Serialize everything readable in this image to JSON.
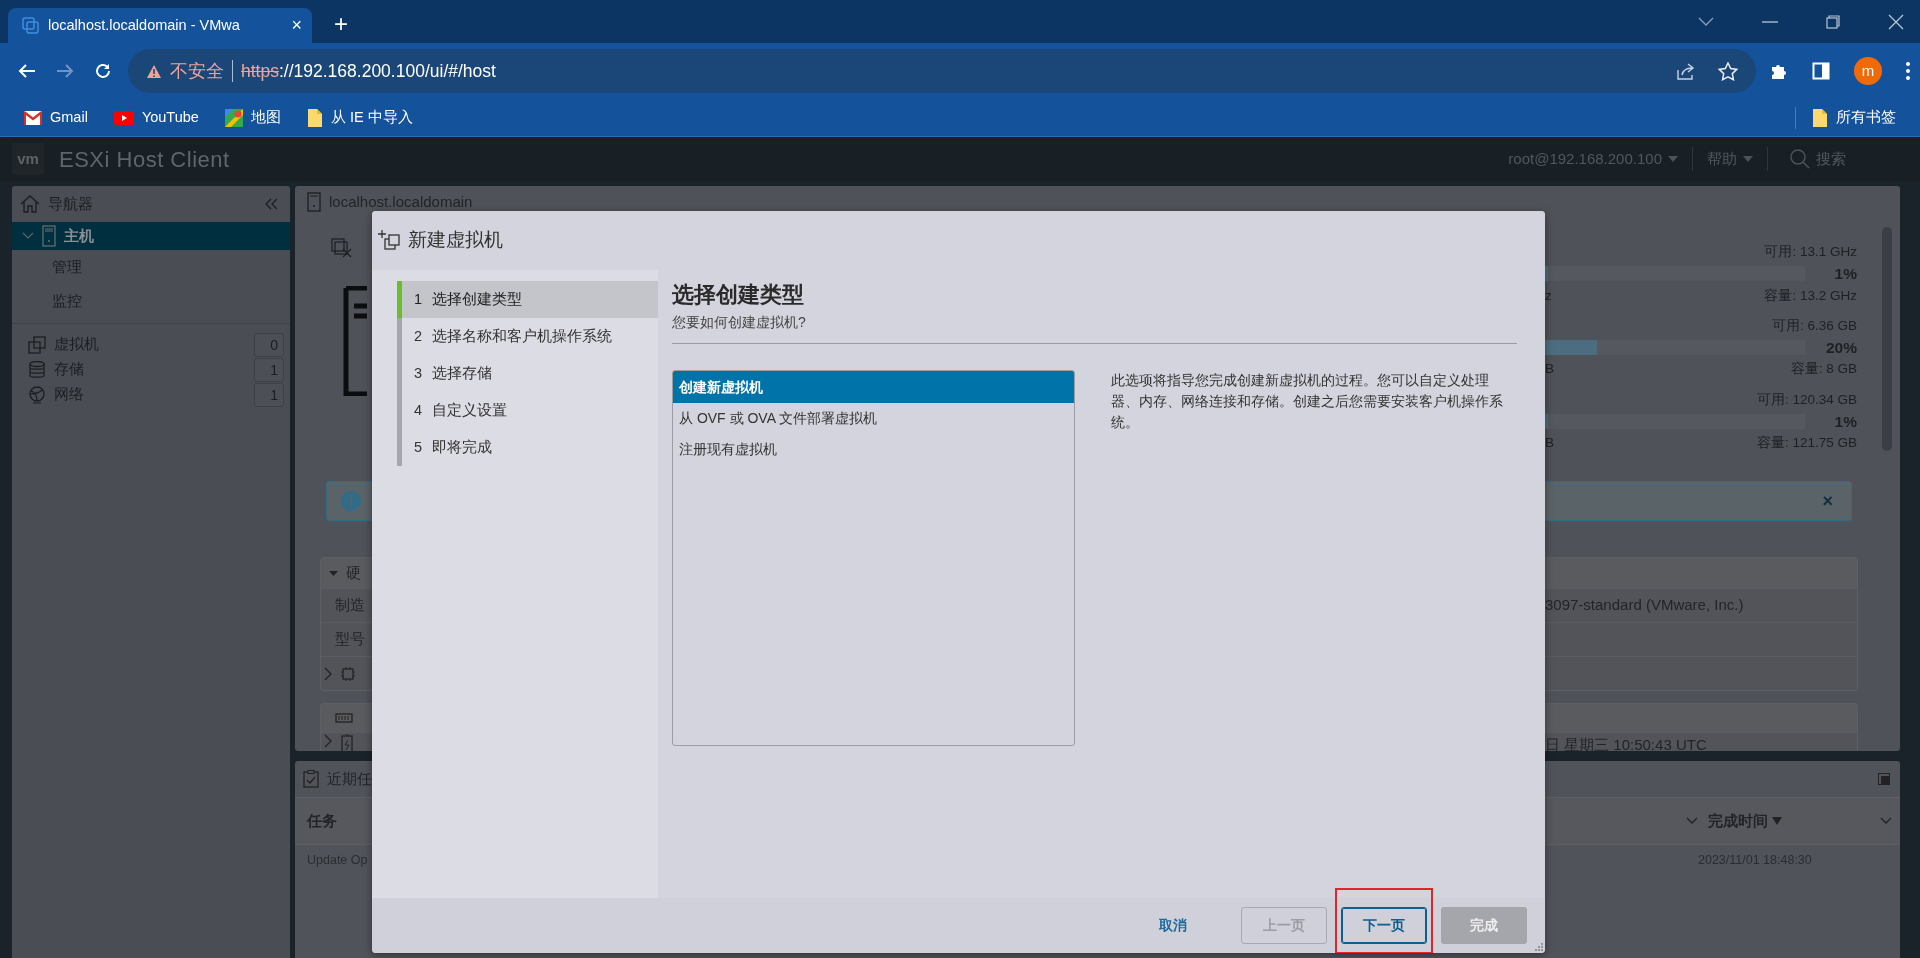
{
  "browser": {
    "tab": {
      "title": "localhost.localdomain - VMwa",
      "close": "×"
    },
    "new_tab": "+",
    "nav_buttons": [
      {
        "kind": "back",
        "disabled": false
      },
      {
        "kind": "forward",
        "disabled": true
      },
      {
        "kind": "reload",
        "disabled": false
      }
    ],
    "address": {
      "security": "不安全",
      "scheme": "https",
      "rest": "://192.168.200.100/ui/#/host"
    },
    "profile": "m",
    "bookmarks": [
      {
        "kind": "gmail",
        "label": "Gmail"
      },
      {
        "kind": "youtube",
        "label": "YouTube"
      },
      {
        "kind": "maps",
        "label": "地图"
      },
      {
        "kind": "folder",
        "label": "从 IE 中导入"
      }
    ],
    "all_bookmarks": "所有书签"
  },
  "app_header": {
    "logo": "vm",
    "title": "ESXi Host Client",
    "user": "root@192.168.200.100",
    "help": "帮助",
    "search": "搜索"
  },
  "navigator": {
    "title": "导航器",
    "items": [
      {
        "label": "主机",
        "selected": true,
        "expanded": true,
        "children": [
          {
            "label": "管理",
            "selected": false
          },
          {
            "label": "监控",
            "selected": false
          }
        ]
      }
    ],
    "inventory": [
      {
        "kind": "vms",
        "label": "虚拟机",
        "count": "0"
      },
      {
        "kind": "storage",
        "label": "存储",
        "count": "1"
      },
      {
        "kind": "network",
        "label": "网络",
        "count": "1"
      }
    ]
  },
  "host_panel": {
    "title": "localhost.localdomain",
    "resources": [
      {
        "available": "可用: 13.1 GHz",
        "percent": "1%",
        "level": 0.01,
        "capacity": "容量: 13.2 GHz",
        "fragment": "z"
      },
      {
        "available": "可用: 6.36 GB",
        "percent": "20%",
        "level": 0.2,
        "capacity": "容量: 8 GB",
        "fragment": "B"
      },
      {
        "available": "可用: 120.34 GB",
        "percent": "1%",
        "level": 0.01,
        "capacity": "容量: 121.75 GB",
        "fragment": "B"
      }
    ],
    "alert": {
      "close": "×"
    },
    "hardware": {
      "title": "硬",
      "expanded": true,
      "rows": [
        {
          "kind": "text",
          "label": "制造",
          "value": "3097-standard (VMware, Inc.)"
        },
        {
          "kind": "text",
          "label": "型号"
        },
        {
          "kind": "cpu",
          "expanded": false
        }
      ]
    },
    "system": {
      "rows": [
        {
          "kind": "memory"
        },
        {
          "kind": "device",
          "expanded": false,
          "value": "日 星期三 10:50:43 UTC"
        }
      ]
    }
  },
  "tasks": {
    "title": "近期任",
    "columns": [
      {
        "label": "任务",
        "sorted": false
      },
      {
        "label": "完成时间",
        "sorted": true
      }
    ],
    "rows": [
      {
        "task": "Update Op",
        "completed": "2023/11/01 18:48:30"
      }
    ]
  },
  "dialog": {
    "title": "新建虚拟机",
    "steps": [
      {
        "number": "1",
        "label": "选择创建类型",
        "selected": true
      },
      {
        "number": "2",
        "label": "选择名称和客户机操作系统",
        "selected": false
      },
      {
        "number": "3",
        "label": "选择存储",
        "selected": false
      },
      {
        "number": "4",
        "label": "自定义设置",
        "selected": false
      },
      {
        "number": "5",
        "label": "即将完成",
        "selected": false
      }
    ],
    "heading": "选择创建类型",
    "question": "您要如何创建虚拟机?",
    "options": [
      {
        "label": "创建新虚拟机",
        "selected": true
      },
      {
        "label": "从 OVF 或 OVA 文件部署虚拟机",
        "selected": false
      },
      {
        "label": "注册现有虚拟机",
        "selected": false
      }
    ],
    "description": "此选项将指导您完成创建新虚拟机的过程。您可以自定义处理器、内存、网络连接和存储。创建之后您需要安装客户机操作系统。",
    "buttons": [
      {
        "kind": "link",
        "label": "取消",
        "disabled": false,
        "highlighted": false
      },
      {
        "kind": "outline",
        "label": "上一页",
        "disabled": true,
        "highlighted": false
      },
      {
        "kind": "outline",
        "label": "下一页",
        "disabled": false,
        "highlighted": true
      },
      {
        "kind": "primary",
        "label": "完成",
        "disabled": true,
        "highlighted": false
      }
    ]
  }
}
